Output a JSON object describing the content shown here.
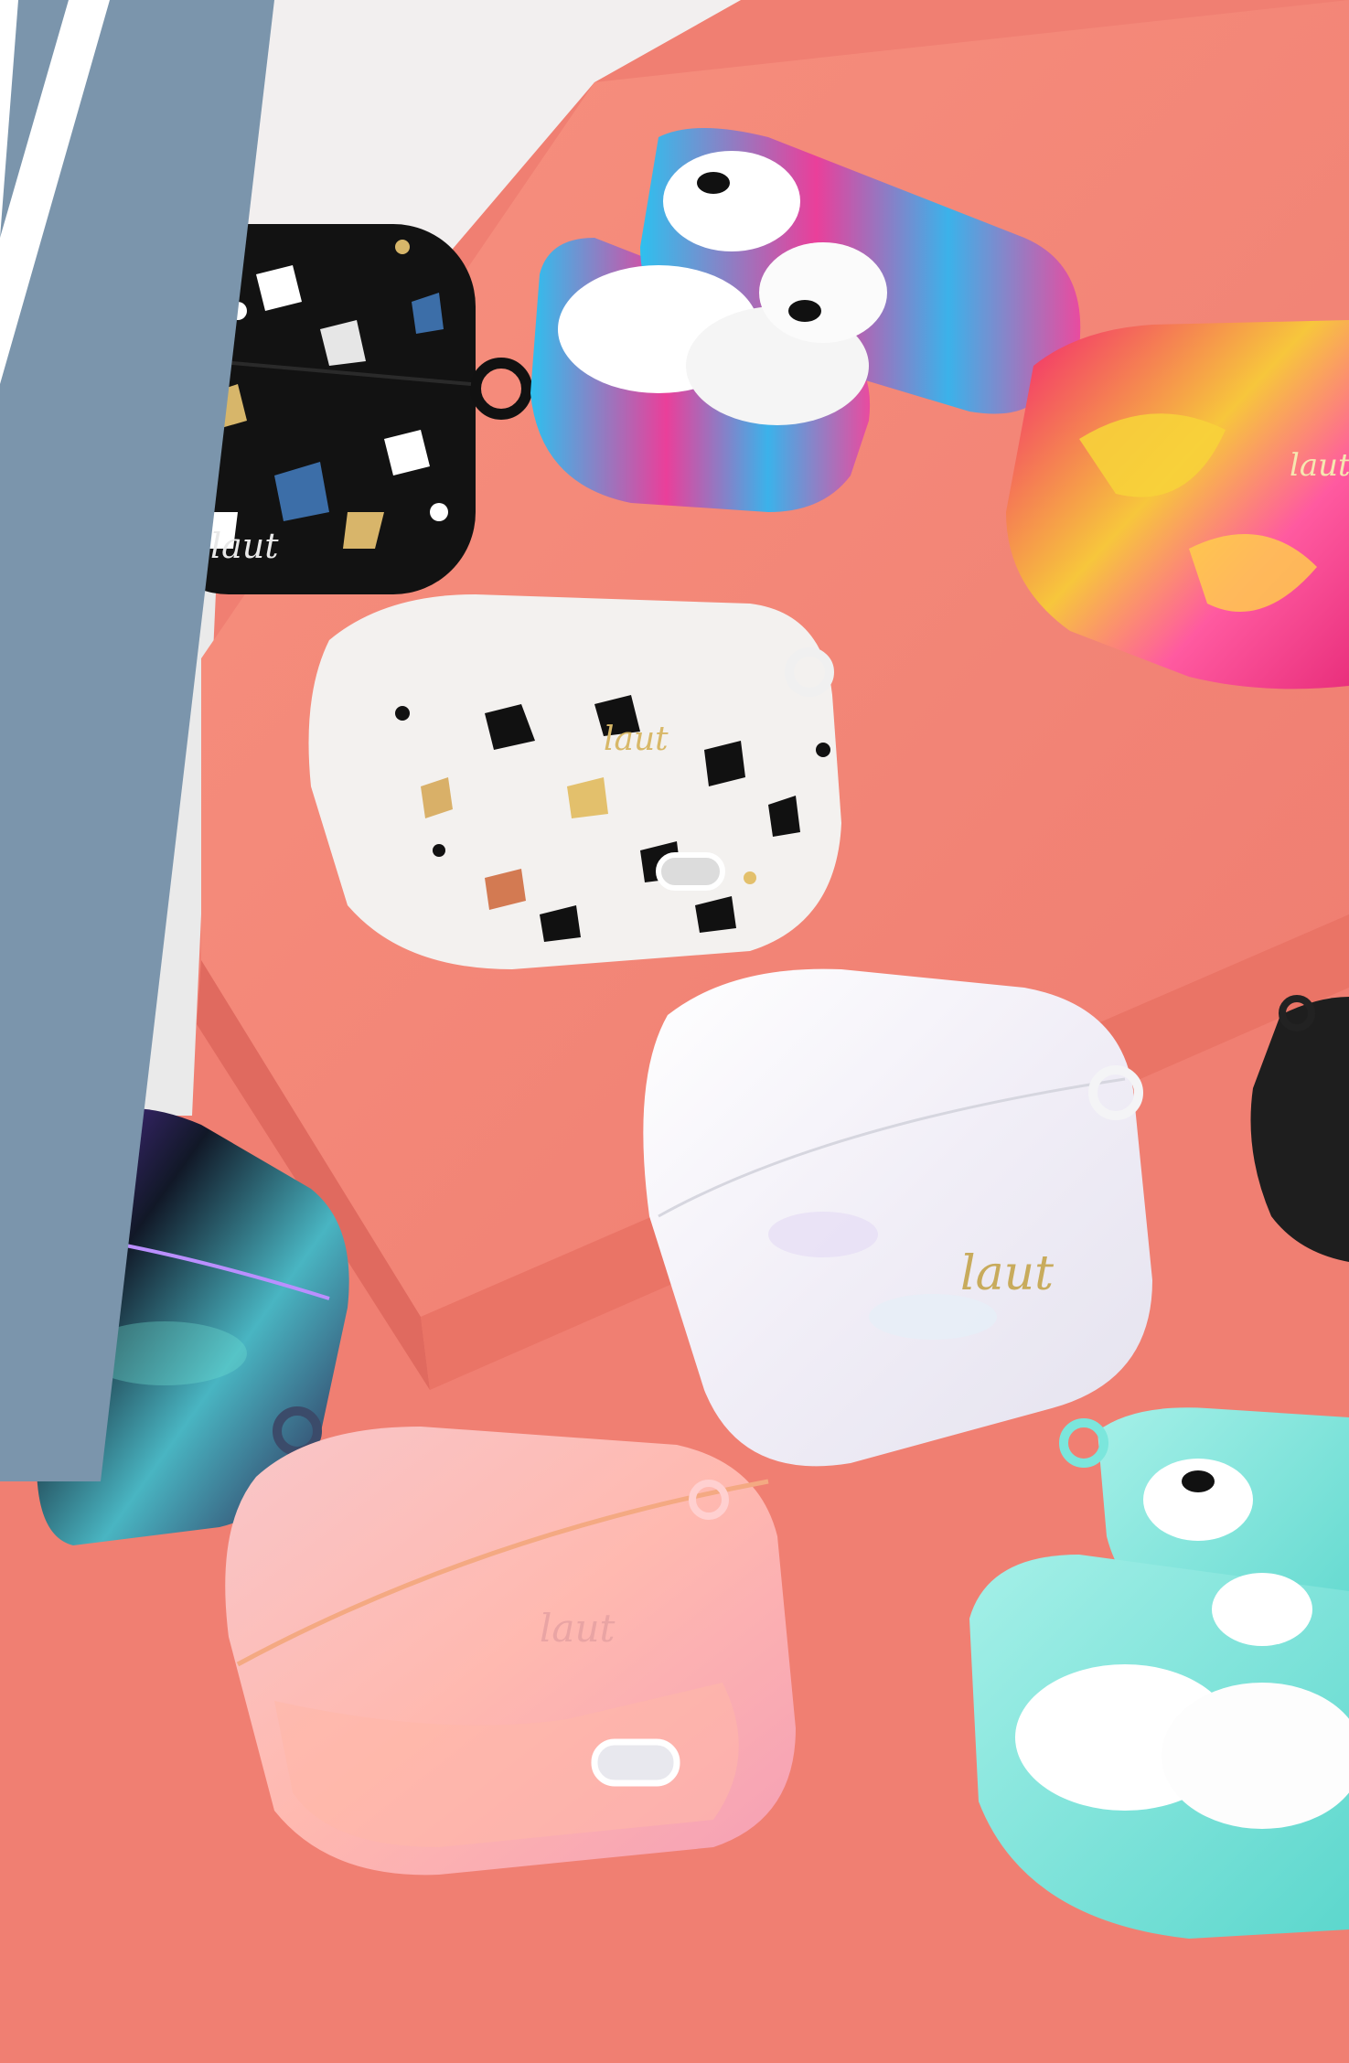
{
  "scene": {
    "description_colors": {
      "background": "#f07f72",
      "platform_top": "#f58b7f",
      "platform_side": "#e46f63",
      "left_band": "#7b95ac",
      "white_plinth": "#f4f2f2"
    },
    "brand_mark": "laut",
    "cases": [
      {
        "id": "black-terrazzo",
        "colors": [
          "#111111",
          "#3c6ea8",
          "#d9b56a",
          "#ffffff"
        ],
        "logo": "laut"
      },
      {
        "id": "blue-tie-dye-open",
        "colors": [
          "#2cb6ea",
          "#ef4aa0",
          "#ffffff"
        ],
        "logo": ""
      },
      {
        "id": "pink-tie-dye",
        "colors": [
          "#f02f7a",
          "#f6d23a",
          "#ff7ab0"
        ],
        "logo": "laut"
      },
      {
        "id": "white-terrazzo",
        "colors": [
          "#f2f0ee",
          "#111111",
          "#e3c06c"
        ],
        "logo": "laut"
      },
      {
        "id": "pearl-white",
        "colors": [
          "#f4f4f8",
          "#ddd7f0",
          "#c7b06f"
        ],
        "logo": "laut"
      },
      {
        "id": "black-partial",
        "colors": [
          "#1c1c1c",
          "#333333"
        ],
        "logo": ""
      },
      {
        "id": "iridescent-black",
        "colors": [
          "#10131b",
          "#5bd2c9",
          "#8b5ff0",
          "#f0a4ff"
        ],
        "logo": ""
      },
      {
        "id": "pink-holographic",
        "colors": [
          "#f6b4b8",
          "#ffd8c9",
          "#ff8fb1"
        ],
        "logo": "laut"
      },
      {
        "id": "mint-open",
        "colors": [
          "#7be6dc",
          "#ffffff",
          "#111111"
        ],
        "logo": ""
      }
    ]
  }
}
